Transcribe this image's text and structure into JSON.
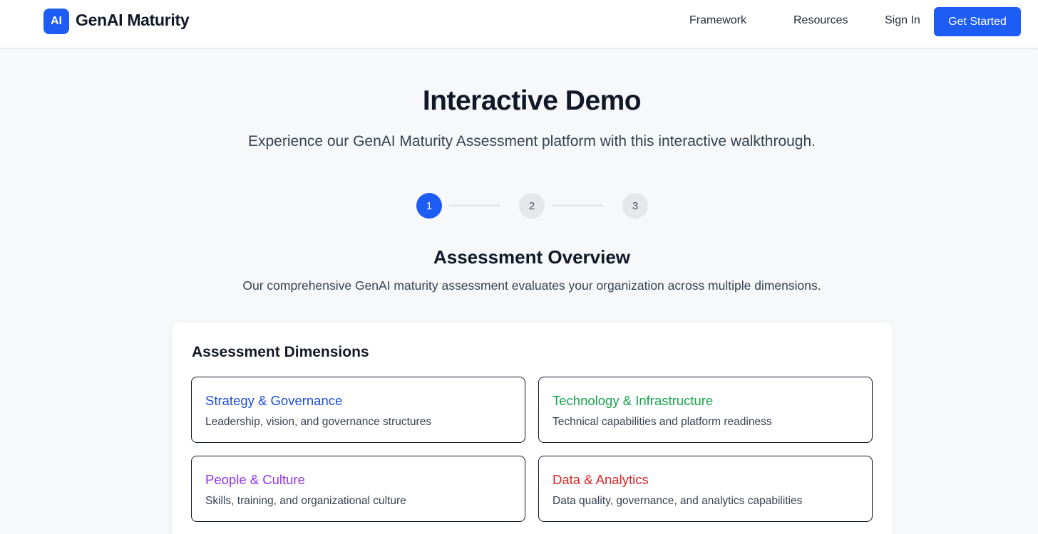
{
  "header": {
    "logo_text": "AI",
    "brand": "GenAI Maturity",
    "nav": {
      "framework": "Framework",
      "resources": "Resources",
      "sign_in": "Sign In",
      "get_started": "Get Started"
    }
  },
  "hero": {
    "title": "Interactive Demo",
    "subtitle": "Experience our GenAI Maturity Assessment platform with this interactive walkthrough."
  },
  "stepper": {
    "steps": [
      "1",
      "2",
      "3"
    ],
    "active_step": 1
  },
  "section": {
    "title": "Assessment Overview",
    "subtitle": "Our comprehensive GenAI maturity assessment evaluates your organization across multiple dimensions."
  },
  "dimensions": {
    "title": "Assessment Dimensions",
    "items": [
      {
        "title": "Strategy & Governance",
        "description": "Leadership, vision, and governance structures",
        "color": "#1d4ed8"
      },
      {
        "title": "Technology & Infrastructure",
        "description": "Technical capabilities and platform readiness",
        "color": "#16a34a"
      },
      {
        "title": "People & Culture",
        "description": "Skills, training, and organizational culture",
        "color": "#9333ea"
      },
      {
        "title": "Data & Analytics",
        "description": "Data quality, governance, and analytics capabilities",
        "color": "#dc2626"
      }
    ]
  },
  "colors": {
    "accent": "#1d5cf5",
    "background": "#f7f8fa"
  }
}
